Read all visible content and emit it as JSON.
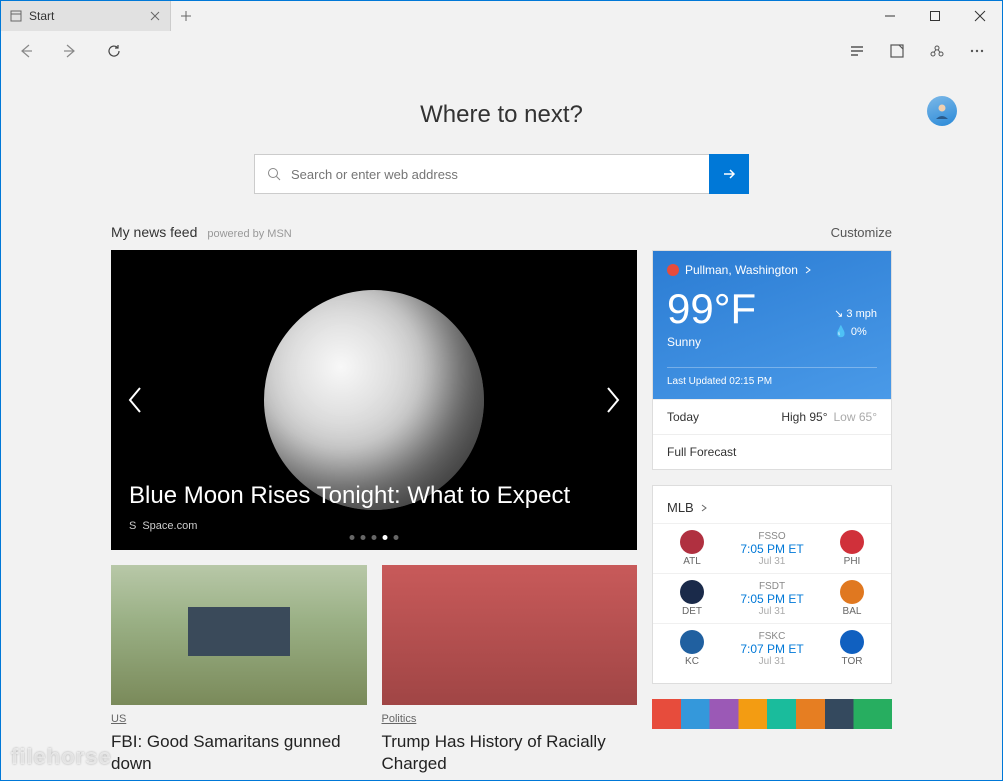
{
  "titlebar": {
    "tab_label": "Start"
  },
  "page": {
    "headline": "Where to next?",
    "customize": "Customize"
  },
  "search": {
    "placeholder": "Search or enter web address"
  },
  "feed": {
    "title": "My news feed",
    "subtitle": "powered by MSN"
  },
  "hero": {
    "title": "Blue Moon Rises Tonight: What to Expect",
    "source": "Space.com",
    "active_dot": 3,
    "total_dots": 5
  },
  "cards": [
    {
      "category": "US",
      "title": "FBI: Good Samaritans gunned down"
    },
    {
      "category": "Politics",
      "title": "Trump Has History of Racially Charged"
    }
  ],
  "weather": {
    "location": "Pullman, Washington",
    "temp": "99°F",
    "condition": "Sunny",
    "wind": "3 mph",
    "humidity": "0%",
    "updated": "Last Updated 02:15 PM",
    "today_label": "Today",
    "high_label": "High 95°",
    "low_label": "Low 65°",
    "forecast_link": "Full Forecast"
  },
  "sports": {
    "league": "MLB",
    "games": [
      {
        "away": "ATL",
        "away_color": "#b03040",
        "home": "PHI",
        "home_color": "#d0303a",
        "net": "FSSO",
        "time": "7:05 PM ET",
        "date": "Jul 31"
      },
      {
        "away": "DET",
        "away_color": "#1a2a4a",
        "home": "BAL",
        "home_color": "#e07820",
        "net": "FSDT",
        "time": "7:05 PM ET",
        "date": "Jul 31"
      },
      {
        "away": "KC",
        "away_color": "#2060a0",
        "home": "TOR",
        "home_color": "#1060c0",
        "net": "FSKC",
        "time": "7:07 PM ET",
        "date": "Jul 31"
      }
    ]
  },
  "watermark": "filehorse"
}
